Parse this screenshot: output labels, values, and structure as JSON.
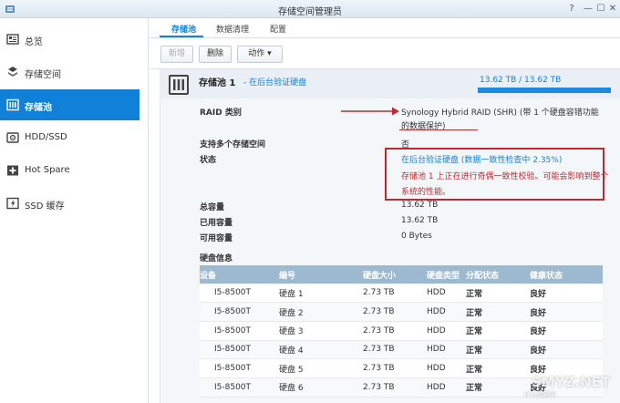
{
  "window": {
    "title": "存储空间管理员",
    "help_icon": "?",
    "minimize_icon": "—",
    "maximize_icon": "☐",
    "close_icon": "✕"
  },
  "sidebar": {
    "items": [
      {
        "label": "总览",
        "icon": "overview-icon"
      },
      {
        "label": "存储空间",
        "icon": "volume-icon"
      },
      {
        "label": "存储池",
        "icon": "storage-pool-icon",
        "active": true
      },
      {
        "label": "HDD/SSD",
        "icon": "hdd-icon"
      },
      {
        "label": "Hot Spare",
        "icon": "hot-spare-icon"
      },
      {
        "label": "SSD 缓存",
        "icon": "ssd-cache-icon"
      }
    ]
  },
  "tabs": [
    {
      "label": "存储池",
      "active": true
    },
    {
      "label": "数据清理"
    },
    {
      "label": "配置"
    }
  ],
  "toolbar": {
    "new_label": "新增",
    "delete_label": "删除",
    "action_label": "动作 ▾"
  },
  "pool": {
    "title": "存储池 1",
    "subtitle": "- 在后台验证硬盘",
    "capacity_text": "13.62 TB / 13.62 TB",
    "capacity_fraction": 1.0
  },
  "details": {
    "raid_label": "RAID 类别",
    "raid_value_line1": "Synology Hybrid RAID (SHR) (带 1 个硬盘容错功能",
    "raid_value_line2": "的数据保护)",
    "multi_label": "支持多个存储空间",
    "multi_value": "否",
    "status_label": "状态",
    "status_line1": "在后台验证硬盘 (数据一致性检查中 2.35%)",
    "status_line2": "存储池 1 上正在进行奇偶一致性校验。可能会影响到整个",
    "status_line3": "系统的性能。",
    "total_label": "总容量",
    "total_value": "13.62 TB",
    "used_label": "已用容量",
    "used_value": "13.62 TB",
    "free_label": "可用容量",
    "free_value": "0 Bytes"
  },
  "disks": {
    "title": "硬盘信息",
    "headers": [
      "设备",
      "编号",
      "硬盘大小",
      "硬盘类型",
      "分配状态",
      "健康状态"
    ],
    "rows": [
      [
        "I5-8500T",
        "硬盘 1",
        "2.73 TB",
        "HDD",
        "正常",
        "良好"
      ],
      [
        "I5-8500T",
        "硬盘 2",
        "2.73 TB",
        "HDD",
        "正常",
        "良好"
      ],
      [
        "I5-8500T",
        "硬盘 3",
        "2.73 TB",
        "HDD",
        "正常",
        "良好"
      ],
      [
        "I5-8500T",
        "硬盘 4",
        "2.73 TB",
        "HDD",
        "正常",
        "良好"
      ],
      [
        "I5-8500T",
        "硬盘 5",
        "2.73 TB",
        "HDD",
        "正常",
        "良好"
      ],
      [
        "I5-8500T",
        "硬盘 6",
        "2.73 TB",
        "HDD",
        "正常",
        "良好"
      ]
    ]
  },
  "watermark": {
    "main": "SMYZ.NET",
    "sub": "什么值得买"
  },
  "colors": {
    "accent": "#1180d8",
    "annotation_red": "#c0282f",
    "ok_green": "#1aa21a"
  }
}
